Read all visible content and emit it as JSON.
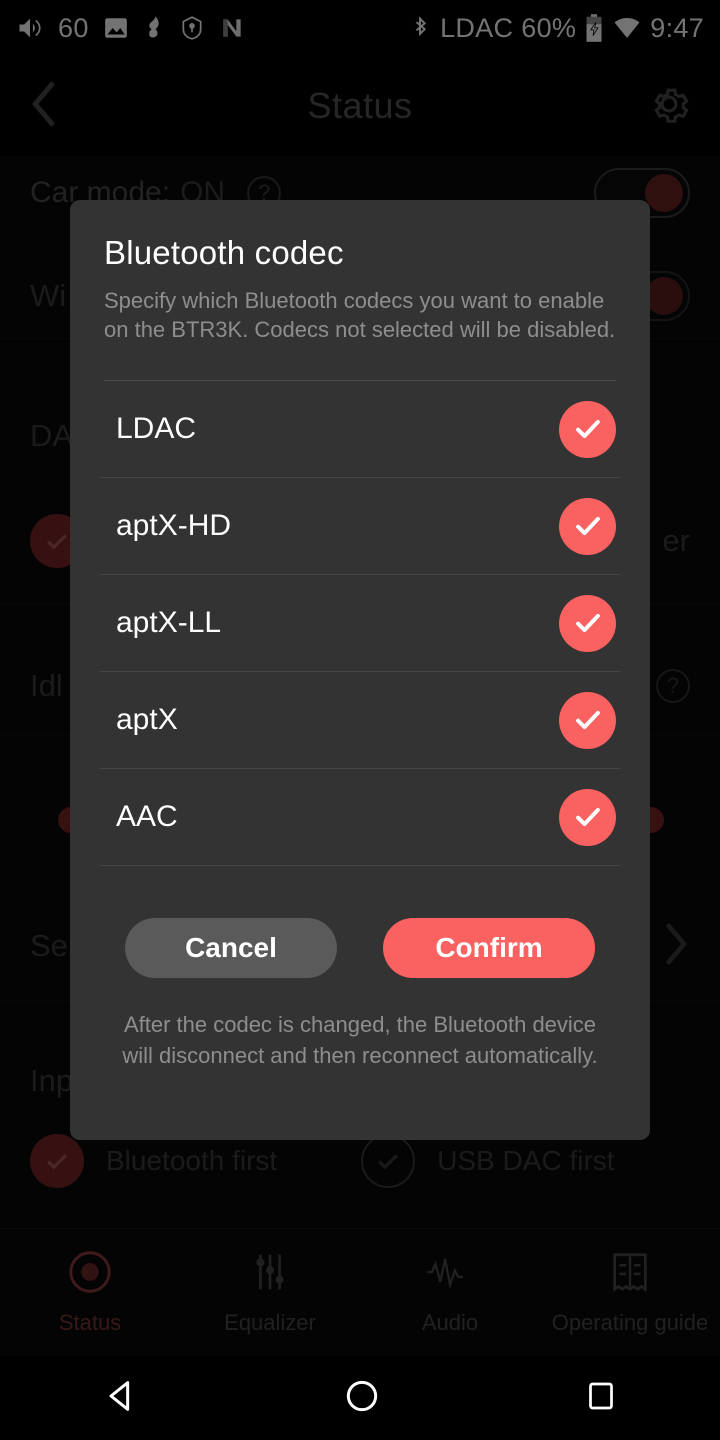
{
  "statusbar": {
    "volume_icon": "volume-up-icon",
    "volume_level": "60",
    "gallery_icon": "image-icon",
    "music_note_icon": "music-note-icon",
    "location_icon": "location-pin-icon",
    "nova_icon": "n-letter-icon",
    "bluetooth_icon": "bluetooth-icon",
    "codec_label": "LDAC",
    "battery_percent": "60%",
    "battery_icon": "battery-charging-icon",
    "wifi_icon": "wifi-icon",
    "clock": "9:47"
  },
  "app": {
    "back_icon": "chevron-left-icon",
    "title": "Status",
    "settings_icon": "gear-icon",
    "car_mode_label": "Car mode:",
    "car_mode_value": "ON",
    "help_icon": "question-mark-icon",
    "rows": [
      {
        "label": "Wi",
        "type": "toggle"
      },
      {
        "label": "DA",
        "type": "text"
      },
      {
        "label": "er",
        "type": "text-right"
      },
      {
        "label": "Idl",
        "type": "text"
      },
      {
        "label": "Se",
        "type": "chevron"
      },
      {
        "label": "Inp",
        "type": "text"
      }
    ],
    "input_options": [
      {
        "label": "Bluetooth first",
        "selected": true
      },
      {
        "label": "USB DAC first",
        "selected": false
      }
    ],
    "tabs": [
      {
        "label": "Status",
        "icon": "record-circle-icon",
        "active": true
      },
      {
        "label": "Equalizer",
        "icon": "sliders-icon",
        "active": false
      },
      {
        "label": "Audio",
        "icon": "waveform-icon",
        "active": false
      },
      {
        "label": "Operating guide",
        "icon": "book-icon",
        "active": false
      }
    ]
  },
  "dialog": {
    "title": "Bluetooth codec",
    "subtitle": "Specify which Bluetooth codecs you want to enable on the BTR3K. Codecs not selected will be disabled.",
    "codecs": [
      {
        "name": "LDAC",
        "checked": true
      },
      {
        "name": "aptX-HD",
        "checked": true
      },
      {
        "name": "aptX-LL",
        "checked": true
      },
      {
        "name": "aptX",
        "checked": true
      },
      {
        "name": "AAC",
        "checked": true
      }
    ],
    "cancel_label": "Cancel",
    "confirm_label": "Confirm",
    "note": "After the codec is changed, the Bluetooth device will disconnect and then reconnect automatically.",
    "check_icon": "checkmark-icon"
  },
  "navbar": {
    "back_icon": "triangle-back-icon",
    "home_icon": "circle-home-icon",
    "recents_icon": "square-recents-icon"
  },
  "colors": {
    "accent": "#fa6161",
    "dialog_bg": "#333333",
    "cancel_bg": "#5a5a5a",
    "screen_bg": "#000000",
    "muted_text": "#8e8e8e"
  }
}
